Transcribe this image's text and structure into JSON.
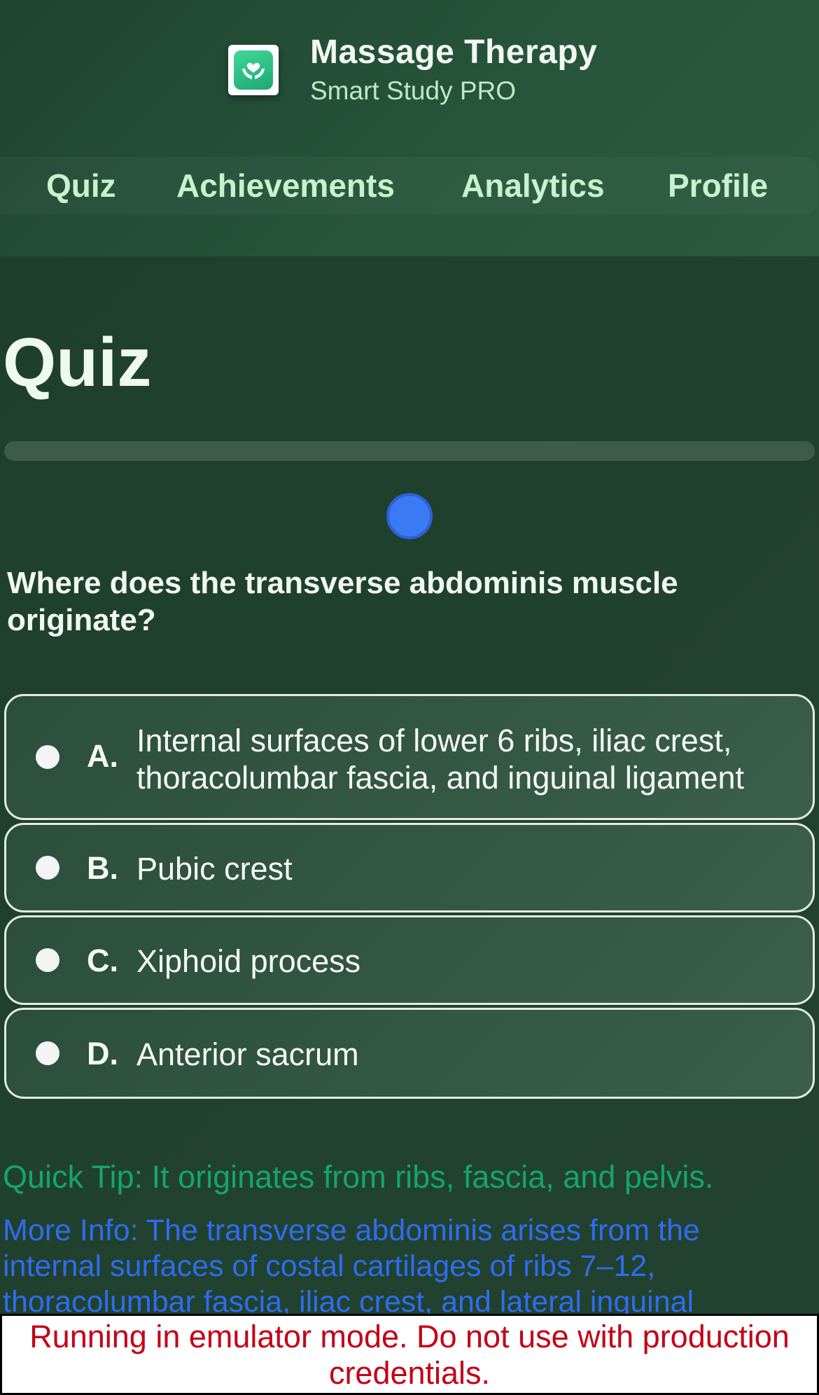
{
  "app": {
    "title": "Massage Therapy",
    "subtitle": "Smart Study PRO",
    "logo_icon": "hands-heart-icon",
    "accent_color": "#3b7af5"
  },
  "nav": {
    "tabs": [
      {
        "label": "Quiz"
      },
      {
        "label": "Achievements"
      },
      {
        "label": "Analytics"
      },
      {
        "label": "Profile"
      }
    ]
  },
  "quiz": {
    "title": "Quiz",
    "progress": 0,
    "question": "Where does the transverse abdominis muscle originate?",
    "options": [
      {
        "letter": "A.",
        "text": "Internal surfaces of lower 6 ribs, iliac crest, thoracolumbar fascia, and inguinal ligament"
      },
      {
        "letter": "B.",
        "text": "Pubic crest"
      },
      {
        "letter": "C.",
        "text": "Xiphoid process"
      },
      {
        "letter": "D.",
        "text": "Anterior sacrum"
      }
    ],
    "quick_tip": "Quick Tip: It originates from ribs, fascia, and pelvis.",
    "more_info": "More Info: The transverse abdominis arises from the internal surfaces of costal cartilages of ribs 7–12, thoracolumbar fascia, iliac crest, and lateral inguinal"
  },
  "footer": {
    "warning": "Running in emulator mode. Do not use with production credentials."
  }
}
